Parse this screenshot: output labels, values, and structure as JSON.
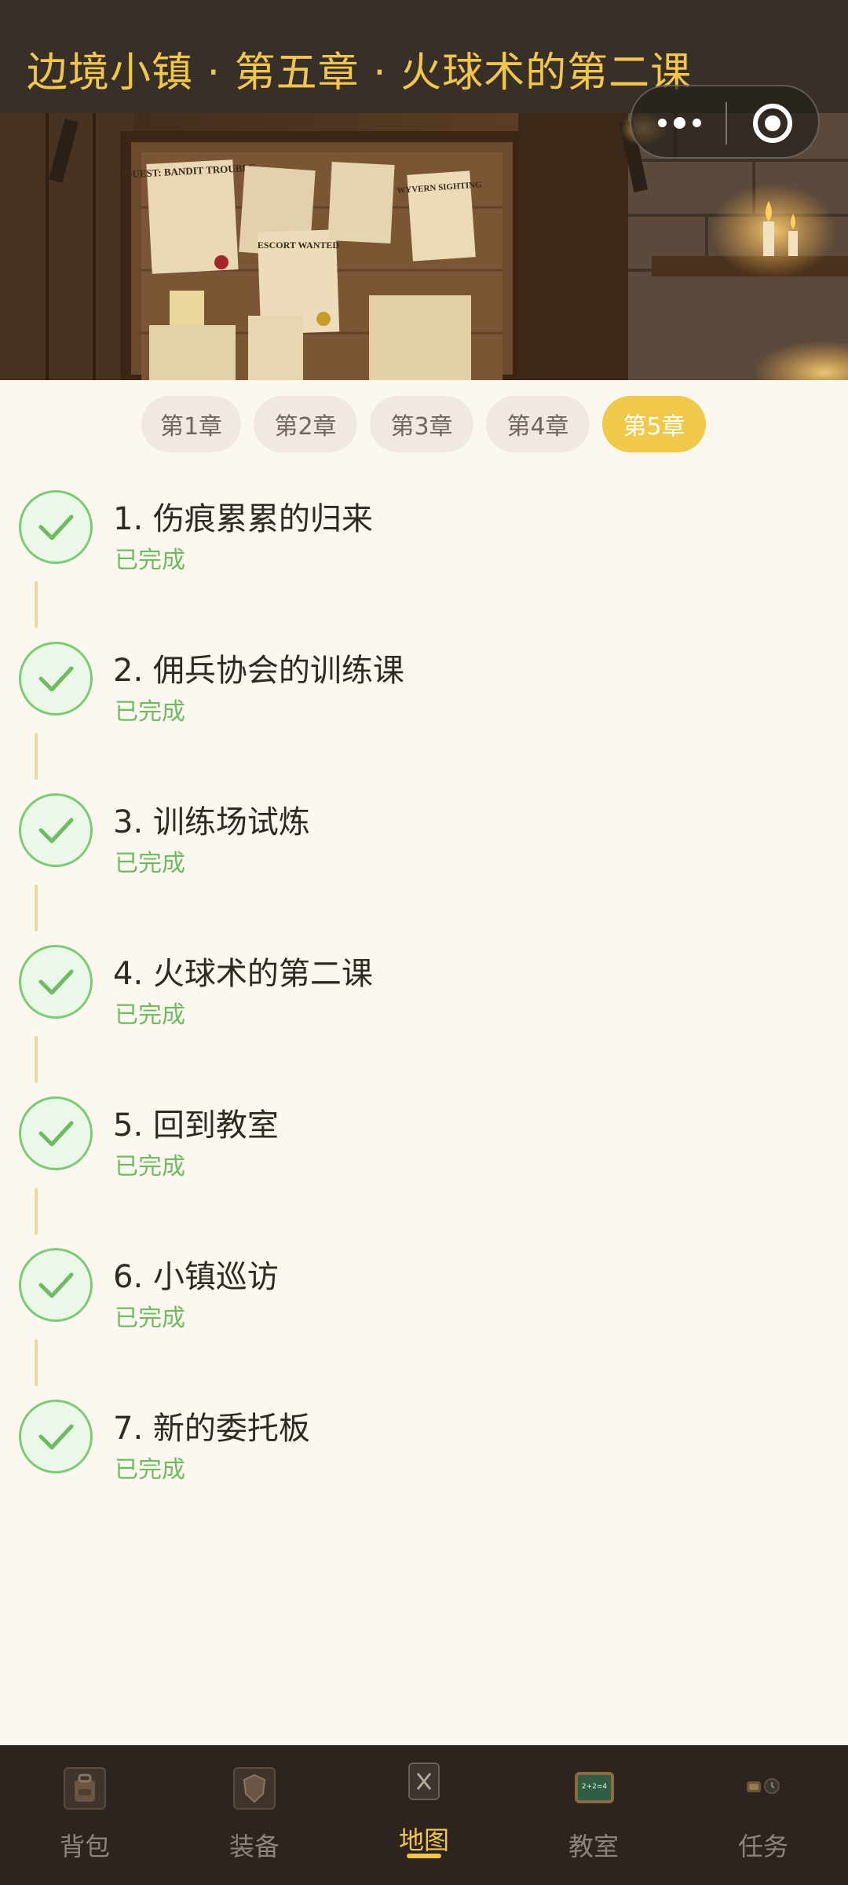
{
  "header": {
    "title": "边境小镇 · 第五章 · 火球术的第二课"
  },
  "banner": {
    "posters": [
      "QUEST: BANDIT TROUBLE",
      "WYVERN SIGHTING",
      "ESCORT WANTED"
    ]
  },
  "chapters": [
    "第1章",
    "第2章",
    "第3章",
    "第4章",
    "第5章"
  ],
  "active_chapter": "第5章",
  "tasks": [
    {
      "title": "1. 伤痕累累的归来",
      "status": "已完成"
    },
    {
      "title": "2. 佣兵协会的训练课",
      "status": "已完成"
    },
    {
      "title": "3. 训练场试炼",
      "status": "已完成"
    },
    {
      "title": "4. 火球术的第二课",
      "status": "已完成"
    },
    {
      "title": "5. 回到教室",
      "status": "已完成"
    },
    {
      "title": "6. 小镇巡访",
      "status": "已完成"
    },
    {
      "title": "7. 新的委托板",
      "status": "已完成"
    }
  ],
  "nav": [
    {
      "label": "背包",
      "icon": "backpack-icon"
    },
    {
      "label": "装备",
      "icon": "equipment-icon"
    },
    {
      "label": "地图",
      "icon": "map-icon"
    },
    {
      "label": "教室",
      "icon": "chalkboard-icon",
      "chalk": "2+2=4"
    },
    {
      "label": "任务",
      "icon": "quest-icon"
    }
  ],
  "active_nav": "地图",
  "colors": {
    "accent": "#f1c64d",
    "header_bg": "#382f28",
    "page_bg": "#fcf8f0",
    "completed": "#6fbb61",
    "nav_bg": "#2d241f"
  }
}
